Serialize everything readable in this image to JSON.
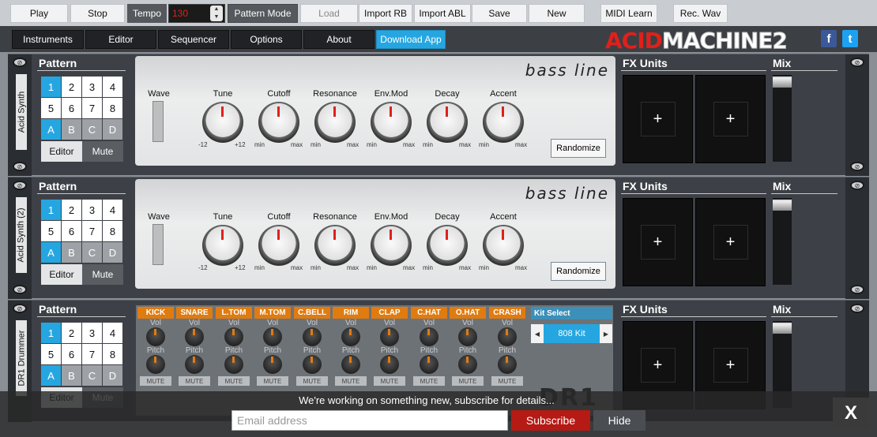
{
  "toolbar": {
    "play": "Play",
    "stop": "Stop",
    "tempo_label": "Tempo",
    "tempo_value": "130",
    "pattern_mode": "Pattern Mode",
    "load": "Load",
    "import_rb": "Import RB",
    "import_abl": "Import ABL",
    "save": "Save",
    "new": "New",
    "midi_learn": "MIDI Learn",
    "rec_wav": "Rec. Wav"
  },
  "nav": {
    "instruments": "Instruments",
    "editor": "Editor",
    "sequencer": "Sequencer",
    "options": "Options",
    "about": "About",
    "download": "Download App"
  },
  "logo": {
    "part1": "ACID",
    "part2": "MACHINE2"
  },
  "social": {
    "facebook": "f",
    "twitter": "t",
    "facebook_color": "#3b5998",
    "twitter_color": "#1da1f2"
  },
  "common": {
    "pattern_title": "Pattern",
    "fx_title": "FX Units",
    "mix_title": "Mix",
    "editor_btn": "Editor",
    "mute_btn": "Mute",
    "randomize": "Randomize",
    "brand": "bass line",
    "wave": "Wave",
    "fx_plus": "+",
    "cells": [
      "1",
      "2",
      "3",
      "4",
      "5",
      "6",
      "7",
      "8",
      "A",
      "B",
      "C",
      "D"
    ]
  },
  "knobs": [
    {
      "label": "Tune",
      "min": "-12",
      "max": "+12"
    },
    {
      "label": "Cutoff",
      "min": "min",
      "max": "max"
    },
    {
      "label": "Resonance",
      "min": "min",
      "max": "max"
    },
    {
      "label": "Env.Mod",
      "min": "min",
      "max": "max"
    },
    {
      "label": "Decay",
      "min": "min",
      "max": "max"
    },
    {
      "label": "Accent",
      "min": "min",
      "max": "max"
    }
  ],
  "racks": [
    {
      "name": "Acid Synth"
    },
    {
      "name": "Acid Synth (2)"
    },
    {
      "name": "DR1 Drummer"
    }
  ],
  "drum": {
    "channels": [
      "KICK",
      "SNARE",
      "L.TOM",
      "M.TOM",
      "C.BELL",
      "RIM",
      "CLAP",
      "C.HAT",
      "O.HAT",
      "CRASH"
    ],
    "vol": "Vol",
    "pitch": "Pitch",
    "mute": "MUTE",
    "kit_select": "Kit Select",
    "kit_value": "808 Kit",
    "kit_prev": "◀",
    "kit_next": "▶",
    "logo": "DR1"
  },
  "newsletter": {
    "message": "We're working on something new, subscribe for details...",
    "email_placeholder": "Email address",
    "subscribe": "Subscribe",
    "hide": "Hide",
    "close": "X"
  },
  "colors": {
    "accent": "#26a6e0",
    "tempo": "#e0201b",
    "drum_label": "#e07b10"
  }
}
